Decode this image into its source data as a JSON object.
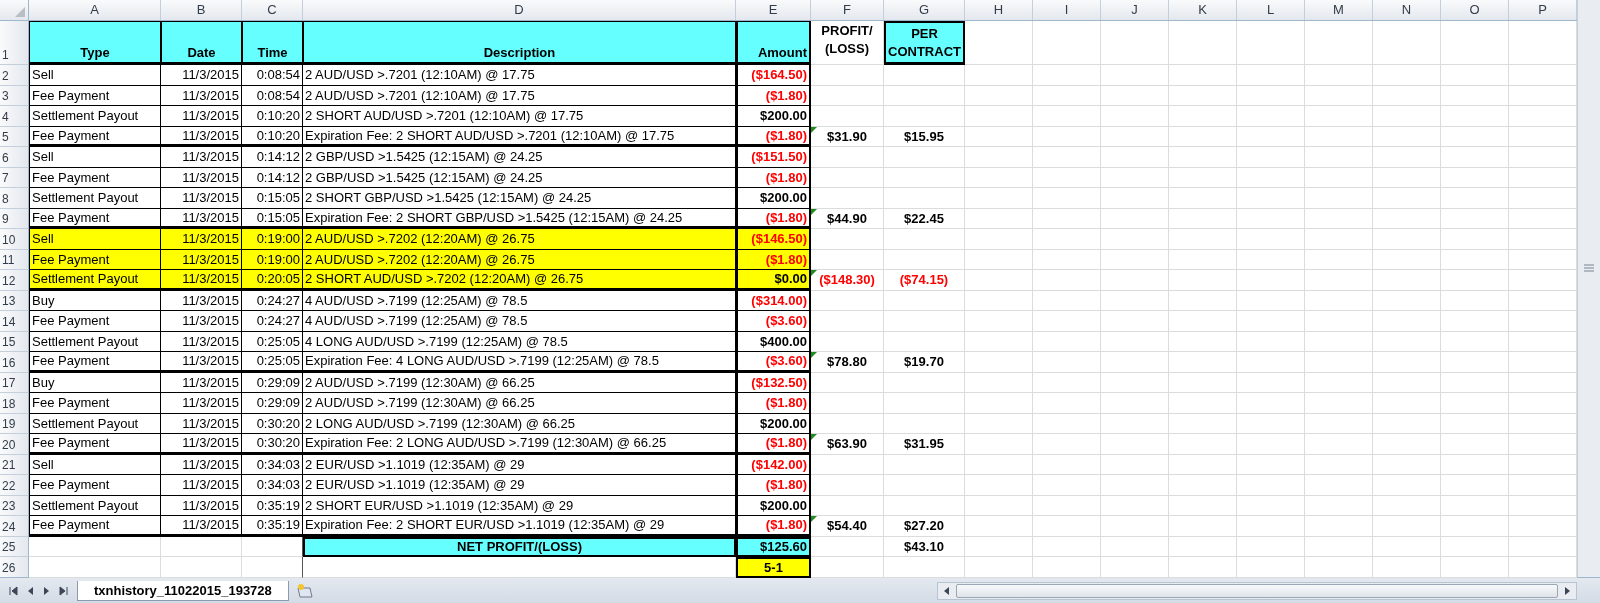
{
  "columns": [
    "A",
    "B",
    "C",
    "D",
    "E",
    "F",
    "G",
    "H",
    "I",
    "J",
    "K",
    "L",
    "M",
    "N",
    "O",
    "P"
  ],
  "header": {
    "row": "1",
    "cells": [
      {
        "text": "Type",
        "filled": true
      },
      {
        "text": "Date",
        "filled": true
      },
      {
        "text": "Time",
        "filled": true
      },
      {
        "text": "Description",
        "filled": true
      },
      {
        "text": "Amount",
        "filled": true
      },
      {
        "text": "PROFIT/ (LOSS)",
        "filled": false
      },
      {
        "text": "PER CONTRACT",
        "filled": true
      }
    ]
  },
  "rows": [
    {
      "row": "2",
      "type": "Sell",
      "date": "11/3/2015",
      "time": "0:08:54",
      "description": "2 AUD/USD >.7201 (12:10AM) @ 17.75",
      "amount": "($164.50)",
      "negative": true,
      "highlight": false,
      "group_end": false,
      "note": false
    },
    {
      "row": "3",
      "type": "Fee Payment",
      "date": "11/3/2015",
      "time": "0:08:54",
      "description": "2 AUD/USD >.7201 (12:10AM) @ 17.75",
      "amount": "($1.80)",
      "negative": true,
      "highlight": false,
      "group_end": false,
      "note": false
    },
    {
      "row": "4",
      "type": "Settlement Payout",
      "date": "11/3/2015",
      "time": "0:10:20",
      "description": "2 SHORT AUD/USD >.7201 (12:10AM) @ 17.75",
      "amount": "$200.00",
      "negative": false,
      "highlight": false,
      "group_end": false,
      "note": false
    },
    {
      "row": "5",
      "type": "Fee Payment",
      "date": "11/3/2015",
      "time": "0:10:20",
      "description": "Expiration Fee: 2 SHORT AUD/USD >.7201 (12:10AM) @ 17.75",
      "amount": "($1.80)",
      "negative": true,
      "highlight": false,
      "group_end": true,
      "note": true,
      "profit": "$31.90",
      "per_contract": "$15.95",
      "profit_negative": false
    },
    {
      "row": "6",
      "type": "Sell",
      "date": "11/3/2015",
      "time": "0:14:12",
      "description": "2 GBP/USD >1.5425 (12:15AM) @ 24.25",
      "amount": "($151.50)",
      "negative": true,
      "highlight": false,
      "group_end": false,
      "note": false
    },
    {
      "row": "7",
      "type": "Fee Payment",
      "date": "11/3/2015",
      "time": "0:14:12",
      "description": "2 GBP/USD >1.5425 (12:15AM) @ 24.25",
      "amount": "($1.80)",
      "negative": true,
      "highlight": false,
      "group_end": false,
      "note": false
    },
    {
      "row": "8",
      "type": "Settlement Payout",
      "date": "11/3/2015",
      "time": "0:15:05",
      "description": "2 SHORT GBP/USD >1.5425 (12:15AM) @ 24.25",
      "amount": "$200.00",
      "negative": false,
      "highlight": false,
      "group_end": false,
      "note": false
    },
    {
      "row": "9",
      "type": "Fee Payment",
      "date": "11/3/2015",
      "time": "0:15:05",
      "description": "Expiration Fee: 2 SHORT GBP/USD >1.5425 (12:15AM) @ 24.25",
      "amount": "($1.80)",
      "negative": true,
      "highlight": false,
      "group_end": true,
      "note": true,
      "profit": "$44.90",
      "per_contract": "$22.45",
      "profit_negative": false
    },
    {
      "row": "10",
      "type": "Sell",
      "date": "11/3/2015",
      "time": "0:19:00",
      "description": "2 AUD/USD >.7202 (12:20AM) @ 26.75",
      "amount": "($146.50)",
      "negative": true,
      "highlight": true,
      "group_end": false,
      "note": false
    },
    {
      "row": "11",
      "type": "Fee Payment",
      "date": "11/3/2015",
      "time": "0:19:00",
      "description": "2 AUD/USD >.7202 (12:20AM) @ 26.75",
      "amount": "($1.80)",
      "negative": true,
      "highlight": true,
      "group_end": false,
      "note": false
    },
    {
      "row": "12",
      "type": "Settlement Payout",
      "date": "11/3/2015",
      "time": "0:20:05",
      "description": "2 SHORT AUD/USD >.7202 (12:20AM) @ 26.75",
      "amount": "$0.00",
      "negative": false,
      "highlight": true,
      "group_end": true,
      "note": true,
      "profit": "($148.30)",
      "per_contract": "($74.15)",
      "profit_negative": true
    },
    {
      "row": "13",
      "type": "Buy",
      "date": "11/3/2015",
      "time": "0:24:27",
      "description": "4 AUD/USD >.7199 (12:25AM) @ 78.5",
      "amount": "($314.00)",
      "negative": true,
      "highlight": false,
      "group_end": false,
      "note": false
    },
    {
      "row": "14",
      "type": "Fee Payment",
      "date": "11/3/2015",
      "time": "0:24:27",
      "description": "4 AUD/USD >.7199 (12:25AM) @ 78.5",
      "amount": "($3.60)",
      "negative": true,
      "highlight": false,
      "group_end": false,
      "note": false
    },
    {
      "row": "15",
      "type": "Settlement Payout",
      "date": "11/3/2015",
      "time": "0:25:05",
      "description": "4 LONG AUD/USD >.7199 (12:25AM) @ 78.5",
      "amount": "$400.00",
      "negative": false,
      "highlight": false,
      "group_end": false,
      "note": false
    },
    {
      "row": "16",
      "type": "Fee Payment",
      "date": "11/3/2015",
      "time": "0:25:05",
      "description": "Expiration Fee: 4 LONG AUD/USD >.7199 (12:25AM) @ 78.5",
      "amount": "($3.60)",
      "negative": true,
      "highlight": false,
      "group_end": true,
      "note": true,
      "profit": "$78.80",
      "per_contract": "$19.70",
      "profit_negative": false
    },
    {
      "row": "17",
      "type": "Buy",
      "date": "11/3/2015",
      "time": "0:29:09",
      "description": "2 AUD/USD >.7199 (12:30AM) @ 66.25",
      "amount": "($132.50)",
      "negative": true,
      "highlight": false,
      "group_end": false,
      "note": false
    },
    {
      "row": "18",
      "type": "Fee Payment",
      "date": "11/3/2015",
      "time": "0:29:09",
      "description": "2 AUD/USD >.7199 (12:30AM) @ 66.25",
      "amount": "($1.80)",
      "negative": true,
      "highlight": false,
      "group_end": false,
      "note": false
    },
    {
      "row": "19",
      "type": "Settlement Payout",
      "date": "11/3/2015",
      "time": "0:30:20",
      "description": "2 LONG AUD/USD >.7199 (12:30AM) @ 66.25",
      "amount": "$200.00",
      "negative": false,
      "highlight": false,
      "group_end": false,
      "note": false
    },
    {
      "row": "20",
      "type": "Fee Payment",
      "date": "11/3/2015",
      "time": "0:30:20",
      "description": "Expiration Fee: 2 LONG AUD/USD >.7199 (12:30AM) @ 66.25",
      "amount": "($1.80)",
      "negative": true,
      "highlight": false,
      "group_end": true,
      "note": true,
      "profit": "$63.90",
      "per_contract": "$31.95",
      "profit_negative": false
    },
    {
      "row": "21",
      "type": "Sell",
      "date": "11/3/2015",
      "time": "0:34:03",
      "description": "2 EUR/USD >1.1019 (12:35AM) @ 29",
      "amount": "($142.00)",
      "negative": true,
      "highlight": false,
      "group_end": false,
      "note": false
    },
    {
      "row": "22",
      "type": "Fee Payment",
      "date": "11/3/2015",
      "time": "0:34:03",
      "description": "2 EUR/USD >1.1019 (12:35AM) @ 29",
      "amount": "($1.80)",
      "negative": true,
      "highlight": false,
      "group_end": false,
      "note": false
    },
    {
      "row": "23",
      "type": "Settlement Payout",
      "date": "11/3/2015",
      "time": "0:35:19",
      "description": "2 SHORT EUR/USD >1.1019 (12:35AM) @ 29",
      "amount": "$200.00",
      "negative": false,
      "highlight": false,
      "group_end": false,
      "note": false
    },
    {
      "row": "24",
      "type": "Fee Payment",
      "date": "11/3/2015",
      "time": "0:35:19",
      "description": "Expiration Fee: 2 SHORT EUR/USD >1.1019 (12:35AM) @ 29",
      "amount": "($1.80)",
      "negative": true,
      "highlight": false,
      "group_end": true,
      "note": true,
      "profit": "$54.40",
      "per_contract": "$27.20",
      "profit_negative": false
    }
  ],
  "total": {
    "row": "25",
    "label": "NET PROFIT/(LOSS)",
    "amount": "$125.60",
    "per_contract": "$43.10"
  },
  "ratio": {
    "row": "26",
    "value": "5-1"
  },
  "sheet_tabs": [
    {
      "label": "txnhistory_11022015_193728",
      "selected": true
    }
  ]
}
